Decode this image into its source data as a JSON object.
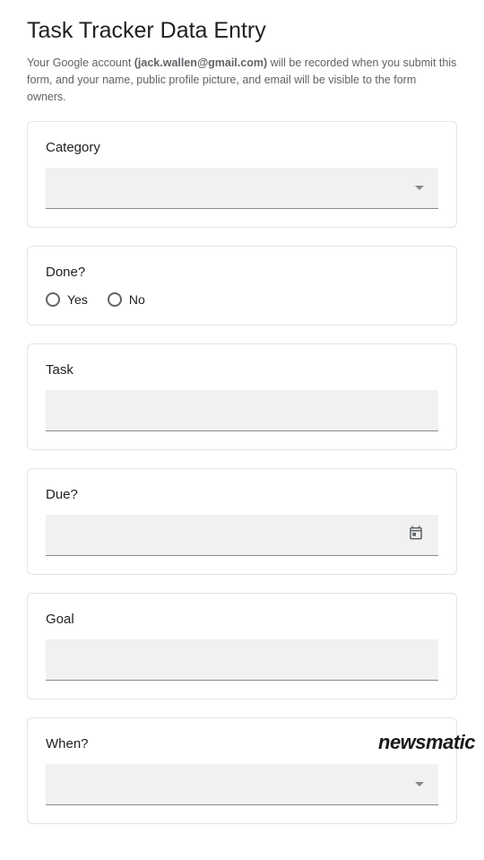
{
  "form": {
    "title": "Task Tracker Data Entry",
    "desc_prefix": "Your Google account ",
    "email": "(jack.wallen@gmail.com)",
    "desc_suffix": " will be recorded when you submit this form, and your name, public profile picture, and email will be visible to the form owners."
  },
  "questions": {
    "category": {
      "label": "Category"
    },
    "done": {
      "label": "Done?",
      "options": {
        "yes": "Yes",
        "no": "No"
      }
    },
    "task": {
      "label": "Task"
    },
    "due": {
      "label": "Due?"
    },
    "goal": {
      "label": "Goal"
    },
    "when": {
      "label": "When?"
    }
  },
  "watermark": "newsmatic"
}
